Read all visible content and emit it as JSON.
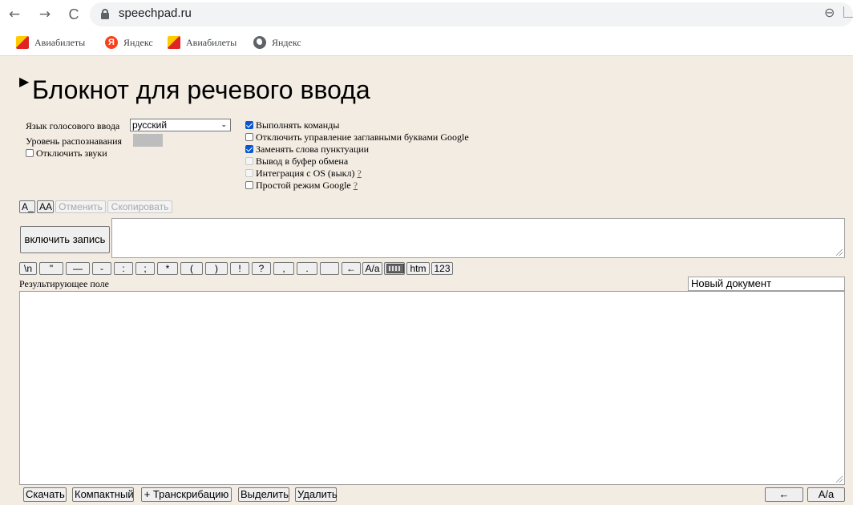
{
  "browser": {
    "back_icon": "←",
    "forward_icon": "→",
    "reload_icon": "C",
    "url": "speechpad.ru",
    "zoom_icon": "zoom-icon"
  },
  "bookmarks": [
    {
      "label": "Авиабилеты",
      "icon": "aviabilety-icon"
    },
    {
      "label": "Яндекс",
      "icon": "yandex-icon"
    },
    {
      "label": "Авиабилеты",
      "icon": "aviabilety-icon"
    },
    {
      "label": "Яндекс",
      "icon": "globe-icon"
    }
  ],
  "page": {
    "title_arrow": "▶",
    "title": "Блокнот для речевого ввода",
    "lang_label": "Язык голосового ввода",
    "lang_value": "русский",
    "level_label": "Уровень распознавания",
    "disable_sounds": "Отключить звуки",
    "options": [
      {
        "label": "Выполнять команды",
        "checked": true,
        "disabled": false,
        "help": ""
      },
      {
        "label": "Отключить управление заглавными буквами Google",
        "checked": false,
        "disabled": false,
        "help": ""
      },
      {
        "label": "Заменять слова пунктуации",
        "checked": true,
        "disabled": false,
        "help": ""
      },
      {
        "label": "Вывод в буфер обмена",
        "checked": false,
        "disabled": true,
        "help": ""
      },
      {
        "label": "Интеграция с OS (выкл)",
        "checked": false,
        "disabled": true,
        "help": "?"
      },
      {
        "label": "Простой режим Google",
        "checked": false,
        "disabled": false,
        "help": "?"
      }
    ],
    "edit_buttons": {
      "a_underscore": "A_",
      "aa": "AA",
      "undo": "Отменить",
      "copy": "Скопировать"
    },
    "record_button": "включить запись",
    "punct_buttons": [
      "\\n",
      "\"",
      "—",
      "-",
      ":",
      ";",
      "*",
      "(",
      ")",
      "!",
      "?",
      ",",
      ".",
      "",
      "←",
      "A/a"
    ],
    "extra_buttons": {
      "htm": "htm",
      "num": "123"
    },
    "result_label": "Результирующее поле",
    "docname_value": "Новый документ",
    "bottom_buttons": {
      "download": "Скачать",
      "compact": "Компактный",
      "transcribe": "+ Транскрибацию",
      "select": "Выделить",
      "delete": "Удалить",
      "back": "←",
      "case": "A/a"
    }
  }
}
